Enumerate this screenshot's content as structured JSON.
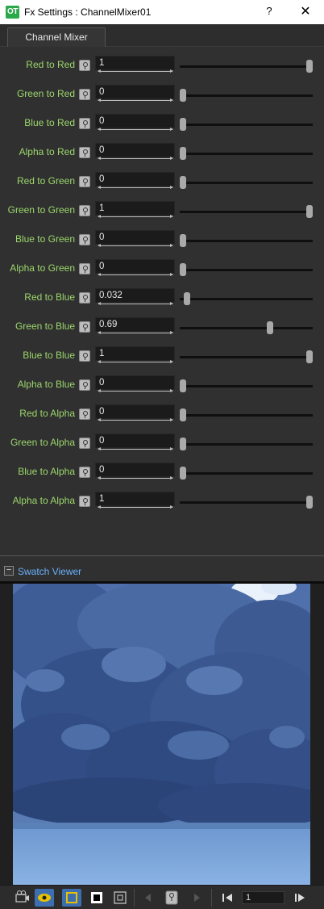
{
  "window": {
    "app_icon_text": "OT",
    "title": "Fx Settings : ChannelMixer01",
    "help_label": "?",
    "close_label": "✕"
  },
  "tabs": [
    {
      "label": "Channel Mixer",
      "active": true
    }
  ],
  "params": [
    {
      "label": "Red to Red",
      "value": "1",
      "level": 1
    },
    {
      "label": "Green to Red",
      "value": "0",
      "level": 0
    },
    {
      "label": "Blue to Red",
      "value": "0",
      "level": 0
    },
    {
      "label": "Alpha to Red",
      "value": "0",
      "level": 0
    },
    {
      "label": "Red to Green",
      "value": "0",
      "level": 0
    },
    {
      "label": "Green to Green",
      "value": "1",
      "level": 1
    },
    {
      "label": "Blue to Green",
      "value": "0",
      "level": 0
    },
    {
      "label": "Alpha to Green",
      "value": "0",
      "level": 0
    },
    {
      "label": "Red to Blue",
      "value": "0.032",
      "level": 0.032
    },
    {
      "label": "Green to Blue",
      "value": "0.69",
      "level": 0.69
    },
    {
      "label": "Blue to Blue",
      "value": "1",
      "level": 1
    },
    {
      "label": "Alpha to Blue",
      "value": "0",
      "level": 0
    },
    {
      "label": "Red to Alpha",
      "value": "0",
      "level": 0
    },
    {
      "label": "Green to Alpha",
      "value": "0",
      "level": 0
    },
    {
      "label": "Blue to Alpha",
      "value": "0",
      "level": 0
    },
    {
      "label": "Alpha to Alpha",
      "value": "1",
      "level": 1
    }
  ],
  "swatch_viewer": {
    "collapse_label": "−",
    "title": "Swatch Viewer"
  },
  "toolbar": {
    "frame_value": "1",
    "icons": [
      "camera-icon",
      "eye-icon",
      "preview-toggle-icon",
      "black-bg-icon",
      "checker-bg-icon",
      "prev-key-icon",
      "key-icon",
      "next-key-icon",
      "prev-frame-icon",
      "next-frame-icon"
    ]
  },
  "colors": {
    "label_green": "#9bd66c",
    "link_blue": "#6ab0ff",
    "panel_bg": "#303030",
    "accent_yellow": "#e8c200",
    "active_button_blue": "#3d6fb0"
  }
}
